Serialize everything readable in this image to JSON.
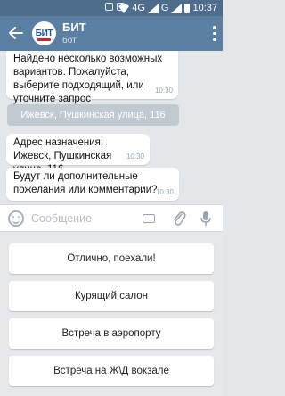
{
  "status_bar": {
    "network": "4G",
    "network2": "G",
    "time": "10:37"
  },
  "app_bar": {
    "logo_text": "БИТ",
    "logo_subtext": "МАСТЕР",
    "title": "БИТ",
    "subtitle": "бот"
  },
  "messages": [
    {
      "text": "Найдено несколько возможных вариантов. Пожалуйста, выберите подходящий, или уточните запрос",
      "time": "10:30"
    },
    {
      "text": "Адрес назначения: Ижевск, Пушкинская улица, 116",
      "time": "10:30"
    },
    {
      "text": "Будут ли дополнительные пожелания или комментарии?",
      "time": "10:30"
    }
  ],
  "inline_button": {
    "label": "Ижевск, Пушкинская улица, 116"
  },
  "input": {
    "placeholder": "Сообщение"
  },
  "keyboard_buttons": [
    {
      "label": "Отлично, поехали!"
    },
    {
      "label": "Курящий салон"
    },
    {
      "label": "Встреча в аэропорту"
    },
    {
      "label": "Встреча на Ж\\Д вокзале"
    }
  ],
  "colors": {
    "status_bar": "#4e6c8c",
    "app_bar": "#5b7fa3",
    "chat_bg": "#e3e7ea",
    "inline_button": "#c1c9d0"
  }
}
